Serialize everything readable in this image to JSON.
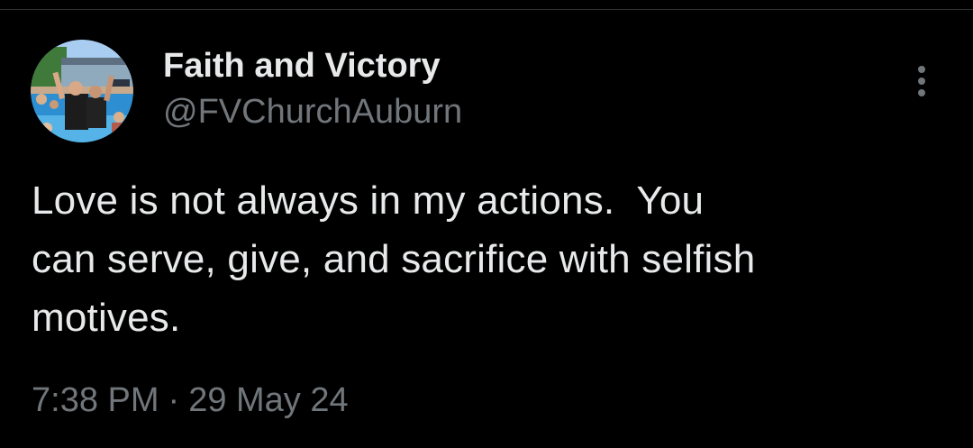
{
  "tweet": {
    "display_name": "Faith and Victory",
    "handle": "@FVChurchAuburn",
    "text_lines": [
      "Love is not always in my actions.  You",
      "can serve, give, and sacrifice with selfish",
      "motives."
    ],
    "time": "7:38 PM",
    "separator": "·",
    "date": "29 May 24"
  },
  "icons": {
    "avatar": "profile-photo",
    "more": "more-vertical-icon"
  },
  "colors": {
    "background": "#000000",
    "primary_text": "#e7e9ea",
    "secondary_text": "#71767b",
    "divider": "#2f3336"
  }
}
